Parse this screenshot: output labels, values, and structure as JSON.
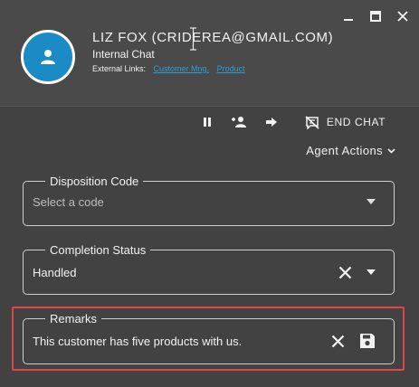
{
  "header": {
    "contact_name": "LIZ FOX (CRIDEREA@GMAIL.COM)",
    "chat_type": "Internal Chat",
    "external_links_label": "External Links:",
    "links": [
      "Customer Mng.",
      "Product"
    ]
  },
  "toolbar": {
    "end_chat_label": "END CHAT"
  },
  "agent_actions_label": "Agent Actions",
  "disposition": {
    "legend": "Disposition Code",
    "placeholder": "Select a code"
  },
  "completion": {
    "legend": "Completion Status",
    "value": "Handled"
  },
  "remarks": {
    "legend": "Remarks",
    "value": "This customer has five products with us."
  },
  "colors": {
    "background": "#424242",
    "header": "#4a4a4a",
    "avatar": "#1a8bc4",
    "link": "#2a9fd6",
    "highlight": "#e04545"
  },
  "icons": [
    "minimize-icon",
    "maximize-icon",
    "close-icon",
    "user-icon",
    "pause-icon",
    "add-user-icon",
    "transfer-arrow-icon",
    "end-chat-icon",
    "chevron-down-icon",
    "dropdown-caret-icon",
    "clear-x-icon",
    "save-icon"
  ]
}
